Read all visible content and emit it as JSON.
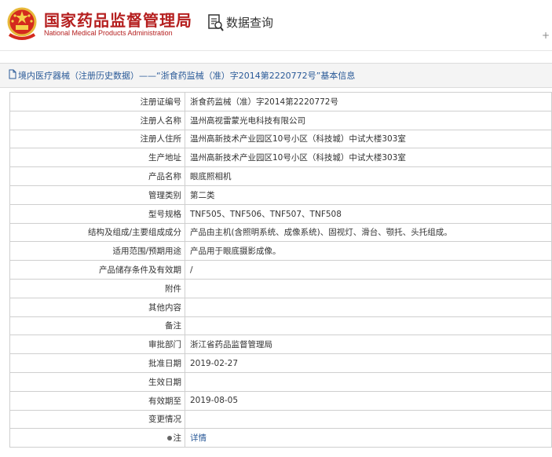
{
  "header": {
    "site_title": "国家药品监督管理局",
    "site_subtitle": "National Medical Products Administration",
    "query_label": "数据查询",
    "scroll_plus": "+"
  },
  "band": {
    "title": "境内医疗器械（注册历史数据）——“浙食药监械（准）字2014第2220772号”基本信息"
  },
  "rows": [
    {
      "label": "注册证编号",
      "value": "浙食药监械（准）字2014第2220772号"
    },
    {
      "label": "注册人名称",
      "value": "温州高视雷蒙光电科技有限公司"
    },
    {
      "label": "注册人住所",
      "value": "温州高新技术产业园区10号小区（科技城）中试大楼303室"
    },
    {
      "label": "生产地址",
      "value": "温州高新技术产业园区10号小区（科技城）中试大楼303室"
    },
    {
      "label": "产品名称",
      "value": "眼底照相机"
    },
    {
      "label": "管理类别",
      "value": "第二类"
    },
    {
      "label": "型号规格",
      "value": "TNF505、TNF506、TNF507、TNF508"
    },
    {
      "label": "结构及组成/主要组成成分",
      "value": "产品由主机(含照明系统、成像系统)、固视灯、滑台、颚托、头托组成。"
    },
    {
      "label": "适用范围/预期用途",
      "value": "产品用于眼底摄影成像。"
    },
    {
      "label": "产品储存条件及有效期",
      "value": "/"
    },
    {
      "label": "附件",
      "value": ""
    },
    {
      "label": "其他内容",
      "value": ""
    },
    {
      "label": "备注",
      "value": ""
    },
    {
      "label": "审批部门",
      "value": "浙江省药品监督管理局"
    },
    {
      "label": "批准日期",
      "value": "2019-02-27"
    },
    {
      "label": "生效日期",
      "value": ""
    },
    {
      "label": "有效期至",
      "value": "2019-08-05"
    },
    {
      "label": "变更情况",
      "value": ""
    },
    {
      "label": "注",
      "value": "详情"
    }
  ],
  "colors": {
    "brand_red": "#b51f1f",
    "link_blue": "#2a5a98"
  },
  "icons": {
    "emblem": "national-emblem-icon",
    "query": "document-search-icon",
    "band": "document-icon",
    "note": "dot-icon"
  }
}
